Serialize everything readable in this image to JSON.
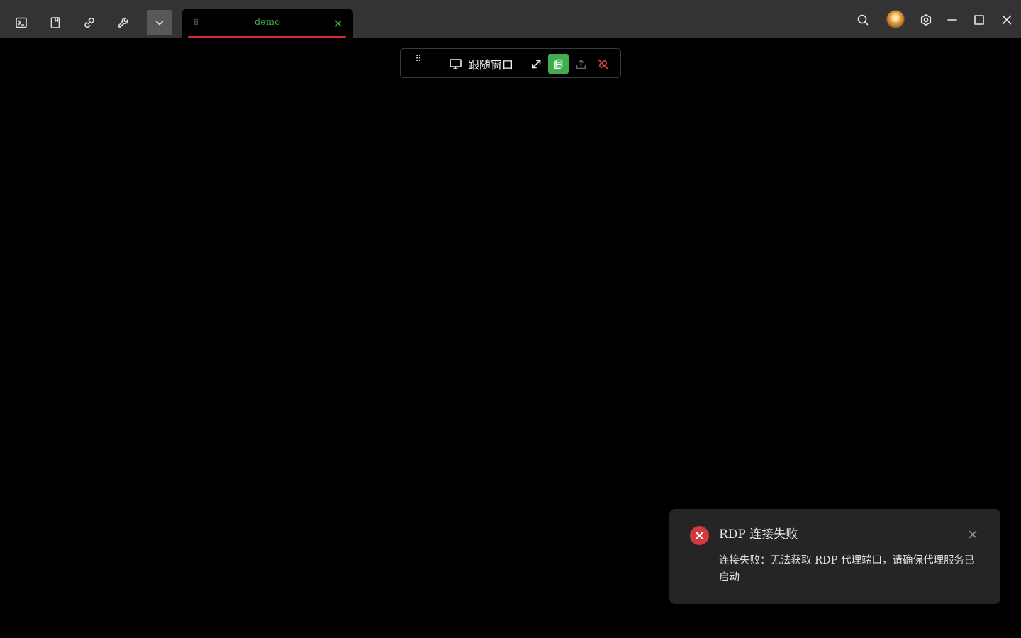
{
  "titlebar": {
    "left_icons": [
      {
        "name": "terminal-icon"
      },
      {
        "name": "bookmark-icon"
      },
      {
        "name": "link-icon"
      },
      {
        "name": "wrench-icon"
      },
      {
        "name": "chevron-down-icon"
      }
    ],
    "tab": {
      "title": "demo",
      "active_color": "#41b04f",
      "underline_color": "#d02d36"
    },
    "right_icons": [
      "search-icon",
      "avatar",
      "settings-icon",
      "minimize-icon",
      "maximize-icon",
      "close-icon"
    ]
  },
  "rdp_toolbar": {
    "display_mode_label": "跟随窗口",
    "buttons": [
      "drag-handle",
      "fullscreen-icon",
      "clipboard-icon",
      "upload-icon",
      "disconnect-icon"
    ],
    "clipboard_active_color": "#3fae4f",
    "disconnect_color": "#e0424a"
  },
  "notification": {
    "type": "error",
    "title": "RDP 连接失败",
    "message": "连接失败：无法获取 RDP 代理端口，请确保代理服务已启动",
    "icon_color": "#d13a3f"
  }
}
